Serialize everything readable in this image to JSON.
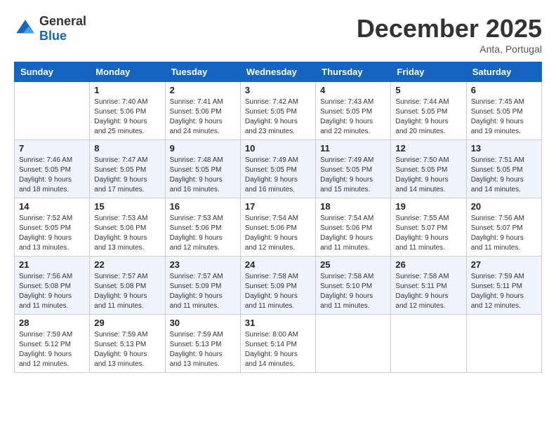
{
  "header": {
    "logo_line1": "General",
    "logo_line2": "Blue",
    "month_title": "December 2025",
    "location": "Anta, Portugal"
  },
  "days_of_week": [
    "Sunday",
    "Monday",
    "Tuesday",
    "Wednesday",
    "Thursday",
    "Friday",
    "Saturday"
  ],
  "weeks": [
    [
      {
        "day": "",
        "info": ""
      },
      {
        "day": "1",
        "info": "Sunrise: 7:40 AM\nSunset: 5:06 PM\nDaylight: 9 hours\nand 25 minutes."
      },
      {
        "day": "2",
        "info": "Sunrise: 7:41 AM\nSunset: 5:06 PM\nDaylight: 9 hours\nand 24 minutes."
      },
      {
        "day": "3",
        "info": "Sunrise: 7:42 AM\nSunset: 5:05 PM\nDaylight: 9 hours\nand 23 minutes."
      },
      {
        "day": "4",
        "info": "Sunrise: 7:43 AM\nSunset: 5:05 PM\nDaylight: 9 hours\nand 22 minutes."
      },
      {
        "day": "5",
        "info": "Sunrise: 7:44 AM\nSunset: 5:05 PM\nDaylight: 9 hours\nand 20 minutes."
      },
      {
        "day": "6",
        "info": "Sunrise: 7:45 AM\nSunset: 5:05 PM\nDaylight: 9 hours\nand 19 minutes."
      }
    ],
    [
      {
        "day": "7",
        "info": "Sunrise: 7:46 AM\nSunset: 5:05 PM\nDaylight: 9 hours\nand 18 minutes."
      },
      {
        "day": "8",
        "info": "Sunrise: 7:47 AM\nSunset: 5:05 PM\nDaylight: 9 hours\nand 17 minutes."
      },
      {
        "day": "9",
        "info": "Sunrise: 7:48 AM\nSunset: 5:05 PM\nDaylight: 9 hours\nand 16 minutes."
      },
      {
        "day": "10",
        "info": "Sunrise: 7:49 AM\nSunset: 5:05 PM\nDaylight: 9 hours\nand 16 minutes."
      },
      {
        "day": "11",
        "info": "Sunrise: 7:49 AM\nSunset: 5:05 PM\nDaylight: 9 hours\nand 15 minutes."
      },
      {
        "day": "12",
        "info": "Sunrise: 7:50 AM\nSunset: 5:05 PM\nDaylight: 9 hours\nand 14 minutes."
      },
      {
        "day": "13",
        "info": "Sunrise: 7:51 AM\nSunset: 5:05 PM\nDaylight: 9 hours\nand 14 minutes."
      }
    ],
    [
      {
        "day": "14",
        "info": "Sunrise: 7:52 AM\nSunset: 5:05 PM\nDaylight: 9 hours\nand 13 minutes."
      },
      {
        "day": "15",
        "info": "Sunrise: 7:53 AM\nSunset: 5:06 PM\nDaylight: 9 hours\nand 13 minutes."
      },
      {
        "day": "16",
        "info": "Sunrise: 7:53 AM\nSunset: 5:06 PM\nDaylight: 9 hours\nand 12 minutes."
      },
      {
        "day": "17",
        "info": "Sunrise: 7:54 AM\nSunset: 5:06 PM\nDaylight: 9 hours\nand 12 minutes."
      },
      {
        "day": "18",
        "info": "Sunrise: 7:54 AM\nSunset: 5:06 PM\nDaylight: 9 hours\nand 11 minutes."
      },
      {
        "day": "19",
        "info": "Sunrise: 7:55 AM\nSunset: 5:07 PM\nDaylight: 9 hours\nand 11 minutes."
      },
      {
        "day": "20",
        "info": "Sunrise: 7:56 AM\nSunset: 5:07 PM\nDaylight: 9 hours\nand 11 minutes."
      }
    ],
    [
      {
        "day": "21",
        "info": "Sunrise: 7:56 AM\nSunset: 5:08 PM\nDaylight: 9 hours\nand 11 minutes."
      },
      {
        "day": "22",
        "info": "Sunrise: 7:57 AM\nSunset: 5:08 PM\nDaylight: 9 hours\nand 11 minutes."
      },
      {
        "day": "23",
        "info": "Sunrise: 7:57 AM\nSunset: 5:09 PM\nDaylight: 9 hours\nand 11 minutes."
      },
      {
        "day": "24",
        "info": "Sunrise: 7:58 AM\nSunset: 5:09 PM\nDaylight: 9 hours\nand 11 minutes."
      },
      {
        "day": "25",
        "info": "Sunrise: 7:58 AM\nSunset: 5:10 PM\nDaylight: 9 hours\nand 11 minutes."
      },
      {
        "day": "26",
        "info": "Sunrise: 7:58 AM\nSunset: 5:11 PM\nDaylight: 9 hours\nand 12 minutes."
      },
      {
        "day": "27",
        "info": "Sunrise: 7:59 AM\nSunset: 5:11 PM\nDaylight: 9 hours\nand 12 minutes."
      }
    ],
    [
      {
        "day": "28",
        "info": "Sunrise: 7:59 AM\nSunset: 5:12 PM\nDaylight: 9 hours\nand 12 minutes."
      },
      {
        "day": "29",
        "info": "Sunrise: 7:59 AM\nSunset: 5:13 PM\nDaylight: 9 hours\nand 13 minutes."
      },
      {
        "day": "30",
        "info": "Sunrise: 7:59 AM\nSunset: 5:13 PM\nDaylight: 9 hours\nand 13 minutes."
      },
      {
        "day": "31",
        "info": "Sunrise: 8:00 AM\nSunset: 5:14 PM\nDaylight: 9 hours\nand 14 minutes."
      },
      {
        "day": "",
        "info": ""
      },
      {
        "day": "",
        "info": ""
      },
      {
        "day": "",
        "info": ""
      }
    ]
  ]
}
